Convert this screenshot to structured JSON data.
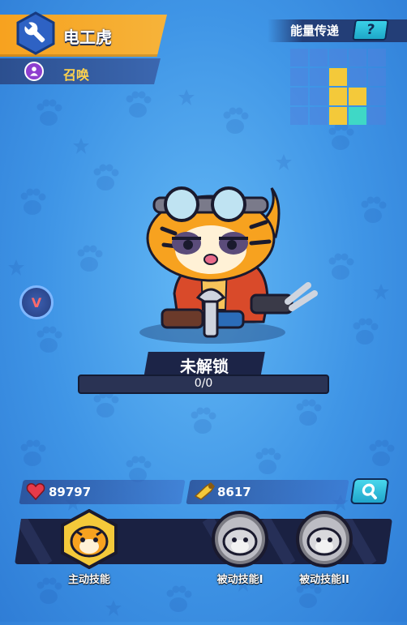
{
  "hero": {
    "name": "电工虎",
    "category": "召唤"
  },
  "energy": {
    "label": "能量传递",
    "help": "?"
  },
  "grid": {
    "cols": 5,
    "rows": 4,
    "cells": [
      "b",
      "b",
      "b",
      "b",
      "b",
      "b",
      "b",
      "y",
      "b",
      "b",
      "b",
      "b",
      "y",
      "y",
      "b",
      "b",
      "b",
      "y",
      "c",
      "b"
    ]
  },
  "badge": {
    "label": "V"
  },
  "status": {
    "label": "未解锁",
    "progress": "0/0",
    "progress_fraction": 0
  },
  "stats": {
    "hp": "89797",
    "attack": "8617"
  },
  "skills": [
    {
      "label": "主动技能",
      "state": "active"
    },
    {
      "label": "被动技能I",
      "state": "locked"
    },
    {
      "label": "被动技能II",
      "state": "locked"
    }
  ],
  "colors": {
    "accent": "#f7a21f",
    "cyan": "#3ad1e8",
    "dark": "#1c2447",
    "yellow": "#f4c93a",
    "teal": "#3fd8c6"
  },
  "icons": [
    "wrench-icon",
    "summon-icon",
    "help-icon",
    "heart-icon",
    "attack-icon",
    "search-icon",
    "tiger-avatar-icon"
  ]
}
